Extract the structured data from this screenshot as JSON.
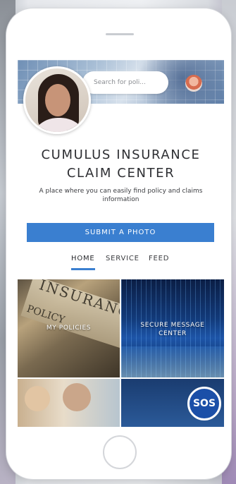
{
  "search": {
    "placeholder": "Search for poli..."
  },
  "header": {
    "title_line1": "CUMULUS INSURANCE",
    "title_line2": "CLAIM CENTER",
    "subtitle": "A place where you can easily find policy and claims information"
  },
  "actions": {
    "submit_label": "SUBMIT A PHOTO"
  },
  "tabs": [
    {
      "label": "HOME",
      "active": true
    },
    {
      "label": "SERVICE",
      "active": false
    },
    {
      "label": "FEED",
      "active": false
    }
  ],
  "tiles": {
    "my_policies": "MY POLICIES",
    "secure_message_line1": "SECURE MESSAGE",
    "secure_message_line2": "CENTER",
    "sos": "SOS"
  },
  "colors": {
    "accent": "#3a7fd0",
    "sos": "#1b4fa8"
  }
}
